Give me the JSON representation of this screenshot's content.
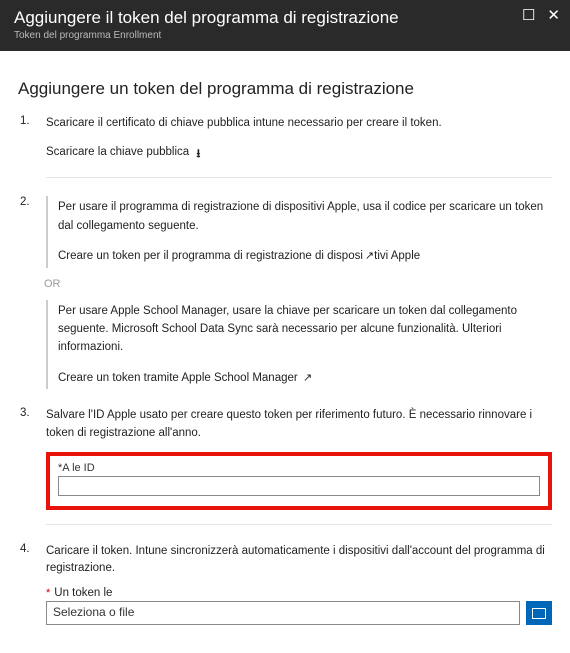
{
  "header": {
    "title": "Aggiungere il token del programma di registrazione",
    "subtitle": "Token del programma Enrollment"
  },
  "section_title": "Aggiungere un token del programma di registrazione",
  "step1": {
    "text": "Scaricare il certificato di chiave pubblica intune necessario per creare il token.",
    "link": "Scaricare la chiave pubblica"
  },
  "step2": {
    "box1_text": "Per usare il programma di registrazione di dispositivi Apple, usa il codice per scaricare un token dal collegamento seguente.",
    "box1_link": "Creare un token per il programma di registrazione di dispositivi Apple",
    "or": "OR",
    "box2_text": "Per usare Apple School Manager, usare la chiave per scaricare un token dal collegamento seguente. Microsoft School Data Sync sarà necessario per alcune funzionalità. Ulteriori informazioni.",
    "box2_link": "Creare un token tramite Apple School Manager"
  },
  "step3": {
    "text": "Salvare l'ID Apple usato per creare questo token per riferimento futuro. È necessario rinnovare i token di registrazione all'anno.",
    "field_label": "*A le ID"
  },
  "step4": {
    "text": "Caricare il token. Intune sincronizzerà automaticamente i dispositivi dall'account del programma di registrazione.",
    "required": "*",
    "token_label": "Un token le",
    "file_placeholder": "Seleziona o file"
  }
}
